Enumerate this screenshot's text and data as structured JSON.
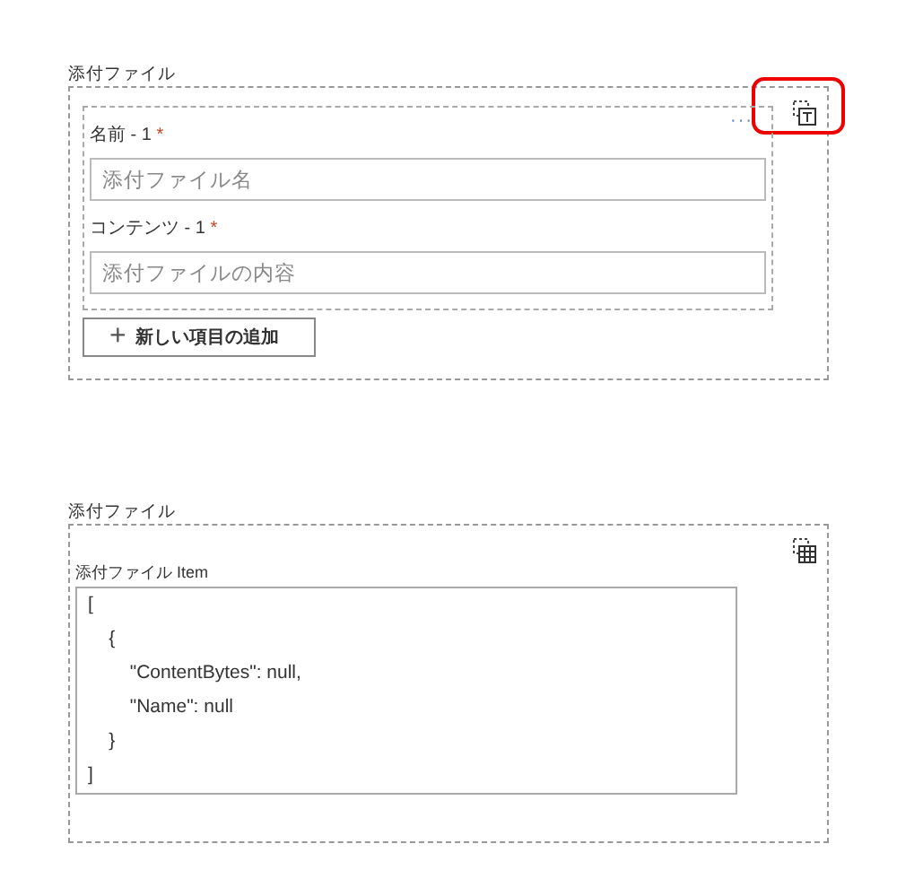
{
  "sections": [
    {
      "kind": "array",
      "label": "添付ファイル",
      "highlighted": true,
      "items": [
        {
          "fields": [
            {
              "label": "名前 - 1",
              "required_mark": "*",
              "placeholder": "添付ファイル名"
            },
            {
              "label": "コンテンツ - 1",
              "required_mark": "*",
              "placeholder": "添付ファイルの内容"
            }
          ],
          "more": "···"
        }
      ],
      "add_button": {
        "icon": "+",
        "label": "新しい項目の追加"
      }
    },
    {
      "kind": "json",
      "label": "添付ファイル",
      "highlighted": false,
      "field_label": "添付ファイル Item",
      "value": "[\n    {\n        \"ContentBytes\": null,\n        \"Name\": null\n    }\n]"
    }
  ]
}
